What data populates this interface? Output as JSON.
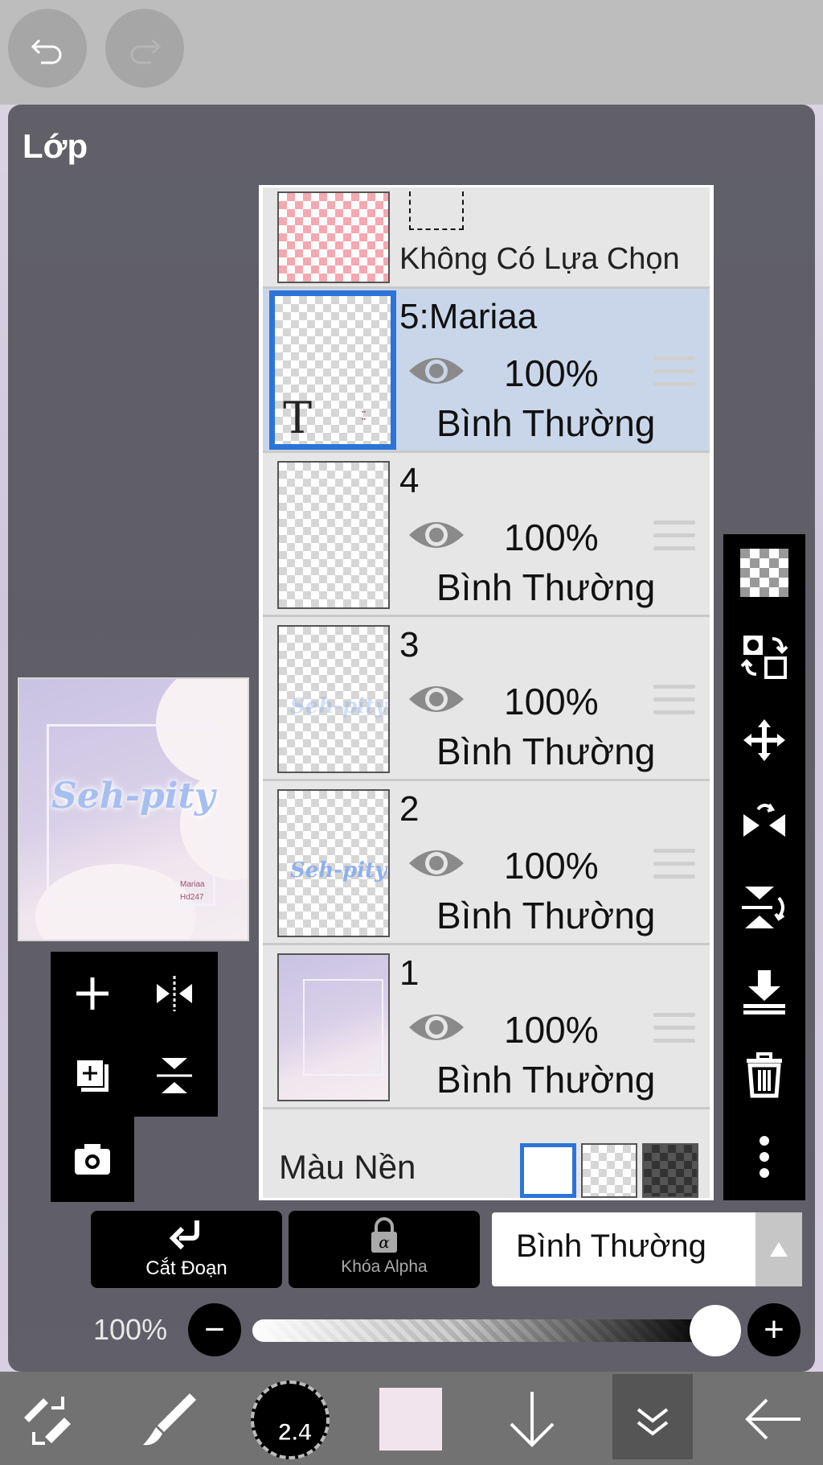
{
  "panel": {
    "title": "Lớp"
  },
  "preview": {
    "script_text": "Seh-pity",
    "signature_line1": "Mariaa",
    "signature_line2": "Hd247"
  },
  "selection_layer": {
    "label": "Không Có Lựa Chọn"
  },
  "layers": [
    {
      "name": "5:Mariaa",
      "opacity": "100%",
      "blend": "Bình Thường",
      "active": true,
      "thumb_text": "T"
    },
    {
      "name": "4",
      "opacity": "100%",
      "blend": "Bình Thường",
      "active": false
    },
    {
      "name": "3",
      "opacity": "100%",
      "blend": "Bình Thường",
      "active": false
    },
    {
      "name": "2",
      "opacity": "100%",
      "blend": "Bình Thường",
      "active": false
    },
    {
      "name": "1",
      "opacity": "100%",
      "blend": "Bình Thường",
      "active": false
    }
  ],
  "background_color": {
    "label": "Màu Nền",
    "options": [
      "white",
      "transparent",
      "dark-checker"
    ],
    "selected": "white"
  },
  "controls": {
    "clip_label": "Cắt Đoạn",
    "alpha_lock_label": "Khóa Alpha",
    "blend_mode": "Bình Thường",
    "opacity_label": "100%",
    "opacity_value": 1.0
  },
  "bottom_toolbar": {
    "brush_size": "2.4",
    "color": "#f2e4ec"
  },
  "colors": {
    "accent": "#2c74d6",
    "active_row": "#c9d6ea",
    "panel": "#505058"
  }
}
